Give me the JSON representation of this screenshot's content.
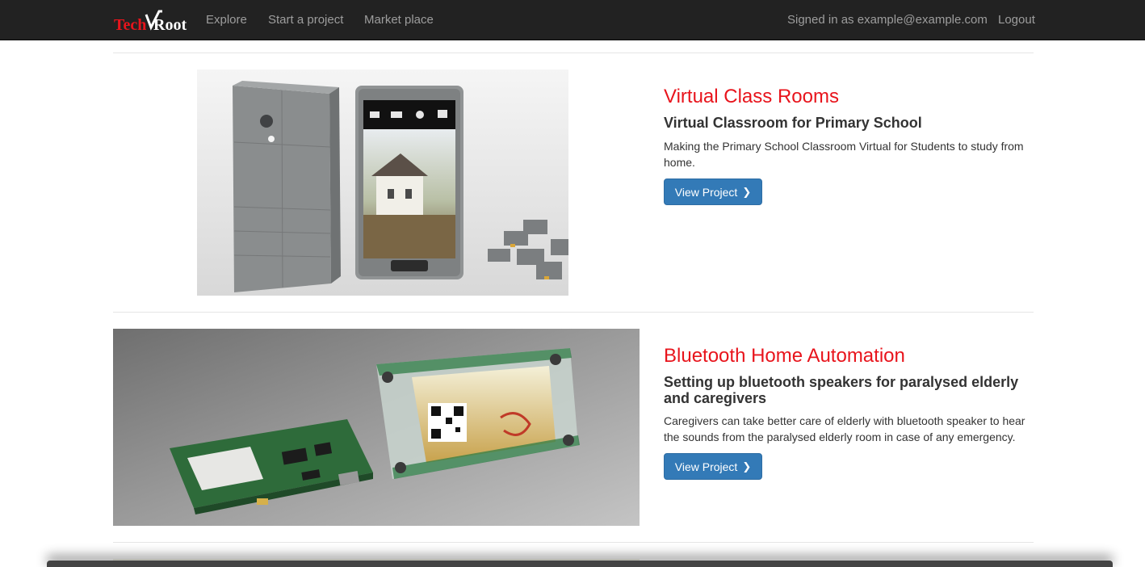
{
  "navbar": {
    "brand": {
      "part1": "Tech",
      "part2": "Root",
      "accent_color": "#e8141c"
    },
    "links": {
      "explore": "Explore",
      "start_project": "Start a project",
      "market_place": "Market place"
    },
    "signed_in": "Signed in as example@example.com",
    "logout": "Logout"
  },
  "projects": [
    {
      "title": "Virtual Class Rooms",
      "subtitle": "Virtual Classroom for Primary School",
      "description": "Making the Primary School Classroom Virtual for Students to study from home.",
      "button_label": "View Project",
      "button_icon": "chevron-right-icon",
      "image": "modular-phone-photo"
    },
    {
      "title": "Bluetooth Home Automation",
      "subtitle": "Setting up bluetooth speakers for paralysed elderly and caregivers",
      "description": "Caregivers can take better care of elderly with bluetooth speaker to hear the sounds from the paralysed elderly room in case of any emergency.",
      "button_label": "View Project",
      "button_icon": "chevron-right-icon",
      "image": "bluetooth-device-photo"
    }
  ],
  "colors": {
    "navbar_bg": "#222222",
    "nav_text": "#9d9d9d",
    "title_red": "#e8141c",
    "button_blue": "#337ab7"
  }
}
